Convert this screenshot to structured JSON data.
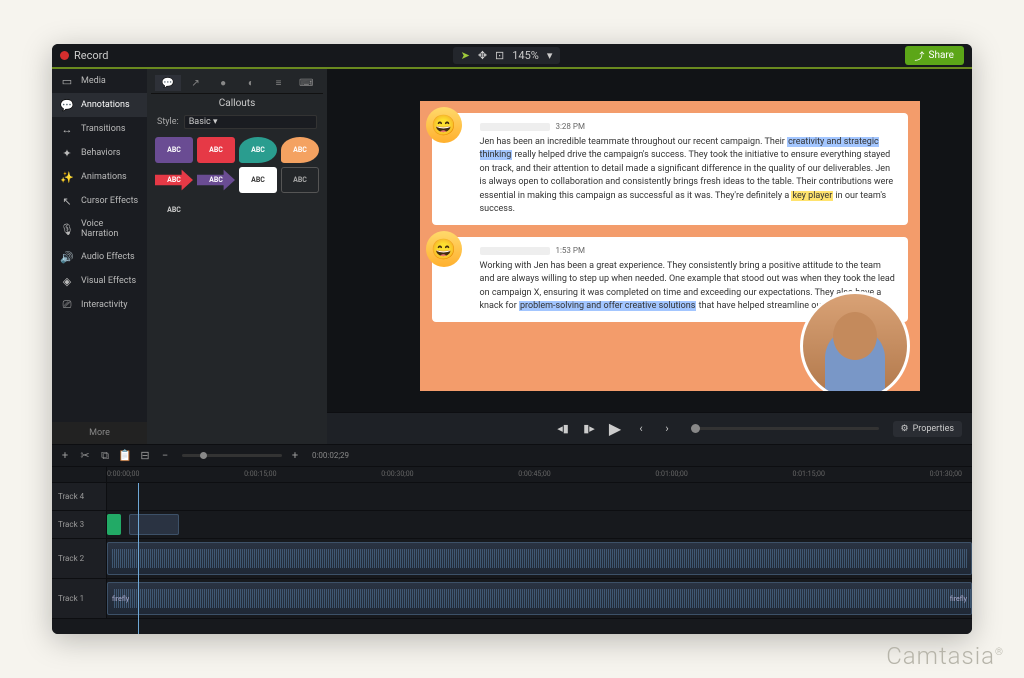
{
  "topbar": {
    "record": "Record",
    "zoom": "145%",
    "share": "Share"
  },
  "sidebar": {
    "items": [
      {
        "icon": "▭",
        "label": "Media"
      },
      {
        "icon": "💬",
        "label": "Annotations"
      },
      {
        "icon": "↔",
        "label": "Transitions"
      },
      {
        "icon": "✦",
        "label": "Behaviors"
      },
      {
        "icon": "✨",
        "label": "Animations"
      },
      {
        "icon": "↖",
        "label": "Cursor Effects"
      },
      {
        "icon": "🎙",
        "label": "Voice Narration"
      },
      {
        "icon": "🔊",
        "label": "Audio Effects"
      },
      {
        "icon": "◈",
        "label": "Visual Effects"
      },
      {
        "icon": "⎚",
        "label": "Interactivity"
      }
    ],
    "more": "More"
  },
  "panel": {
    "title": "Callouts",
    "style_label": "Style:",
    "style_value": "Basic",
    "sample": "ABC"
  },
  "preview": {
    "msg1": {
      "time": "3:28 PM",
      "t1": "Jen has been an incredible teammate throughout our recent campaign. Their ",
      "h1": "creativity and strategic thinking",
      "t2": " really helped drive the campaign's success. They took the initiative to ensure everything stayed on track, and their attention to detail made a significant difference in the quality of our deliverables. Jen is always open to collaboration and consistently brings fresh ideas to the table. Their contributions were essential in making this campaign as successful as it was. They're definitely a ",
      "h2": "key player",
      "t3": " in our team's success."
    },
    "msg2": {
      "time": "1:53 PM",
      "t1": "Working with Jen has been a great experience. They consistently bring a positive attitude to the team and are always willing to step up when needed. One example that stood out was when they took the lead on campaign X, ensuring it was completed on time and exceeding our expectations. They also have a knack for ",
      "h1": "problem-solving and offer creative solutions",
      "t2": " that have helped streamline our"
    }
  },
  "playbar": {
    "properties": "Properties"
  },
  "timeline": {
    "timecode": "0:00:02;29",
    "ruler": [
      "0:00:00;00",
      "0:00:15;00",
      "0:00:30;00",
      "0:00:45;00",
      "0:01:00;00",
      "0:01:15;00",
      "0:01:30;00"
    ],
    "tracks": [
      "Track 4",
      "Track 3",
      "Track 2",
      "Track 1"
    ],
    "clip_label": "firefly",
    "clip_label2": "firefly"
  },
  "brand": "Camtasia"
}
